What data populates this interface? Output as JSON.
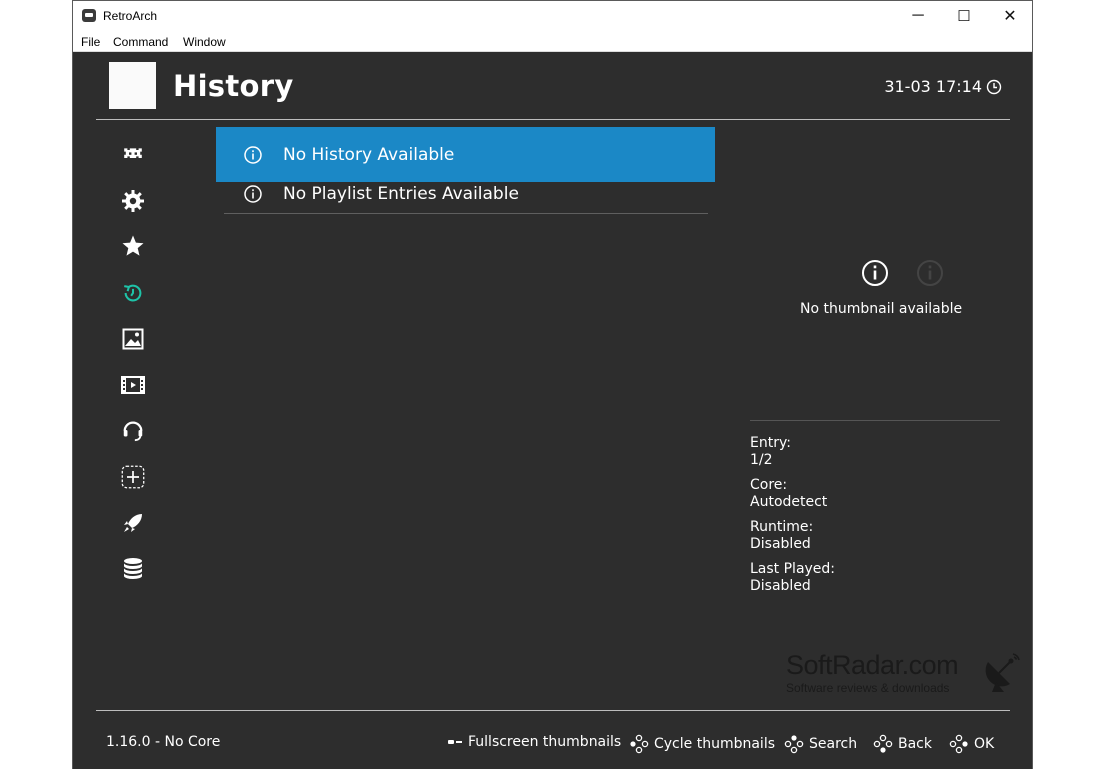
{
  "window": {
    "title": "RetroArch",
    "controls": {
      "minimize": "─",
      "maximize": "☐",
      "close": "✕"
    }
  },
  "menubar": {
    "items": [
      "File",
      "Command",
      "Window"
    ]
  },
  "header": {
    "title": "History",
    "clock": "31-03 17:14"
  },
  "sidebar": {
    "selected_color": "#1ec3a8",
    "icons": [
      "main-menu-invader-icon",
      "settings-gear-icon",
      "favorites-star-icon",
      "history-icon",
      "images-icon",
      "videos-film-icon",
      "netplay-headset-icon",
      "import-content-plus-icon",
      "explore-rocket-icon",
      "database-icon"
    ]
  },
  "list": {
    "selected_color": "#1b88c6",
    "items": [
      {
        "label": "No History Available"
      },
      {
        "label": "No Playlist Entries Available"
      }
    ]
  },
  "thumbnail": {
    "text": "No thumbnail available"
  },
  "meta": {
    "entry_label": "Entry:",
    "entry_value": "1/2",
    "core_label": "Core:",
    "core_value": "Autodetect",
    "runtime_label": "Runtime:",
    "runtime_value": "Disabled",
    "last_played_label": "Last Played:",
    "last_played_value": "Disabled"
  },
  "footer": {
    "version": "1.16.0 - No Core",
    "hints": [
      "Fullscreen thumbnails",
      "Cycle thumbnails",
      "Search",
      "Back",
      "OK"
    ]
  },
  "watermark": {
    "title": "SoftRadar.com",
    "subtitle": "Software reviews & downloads"
  }
}
